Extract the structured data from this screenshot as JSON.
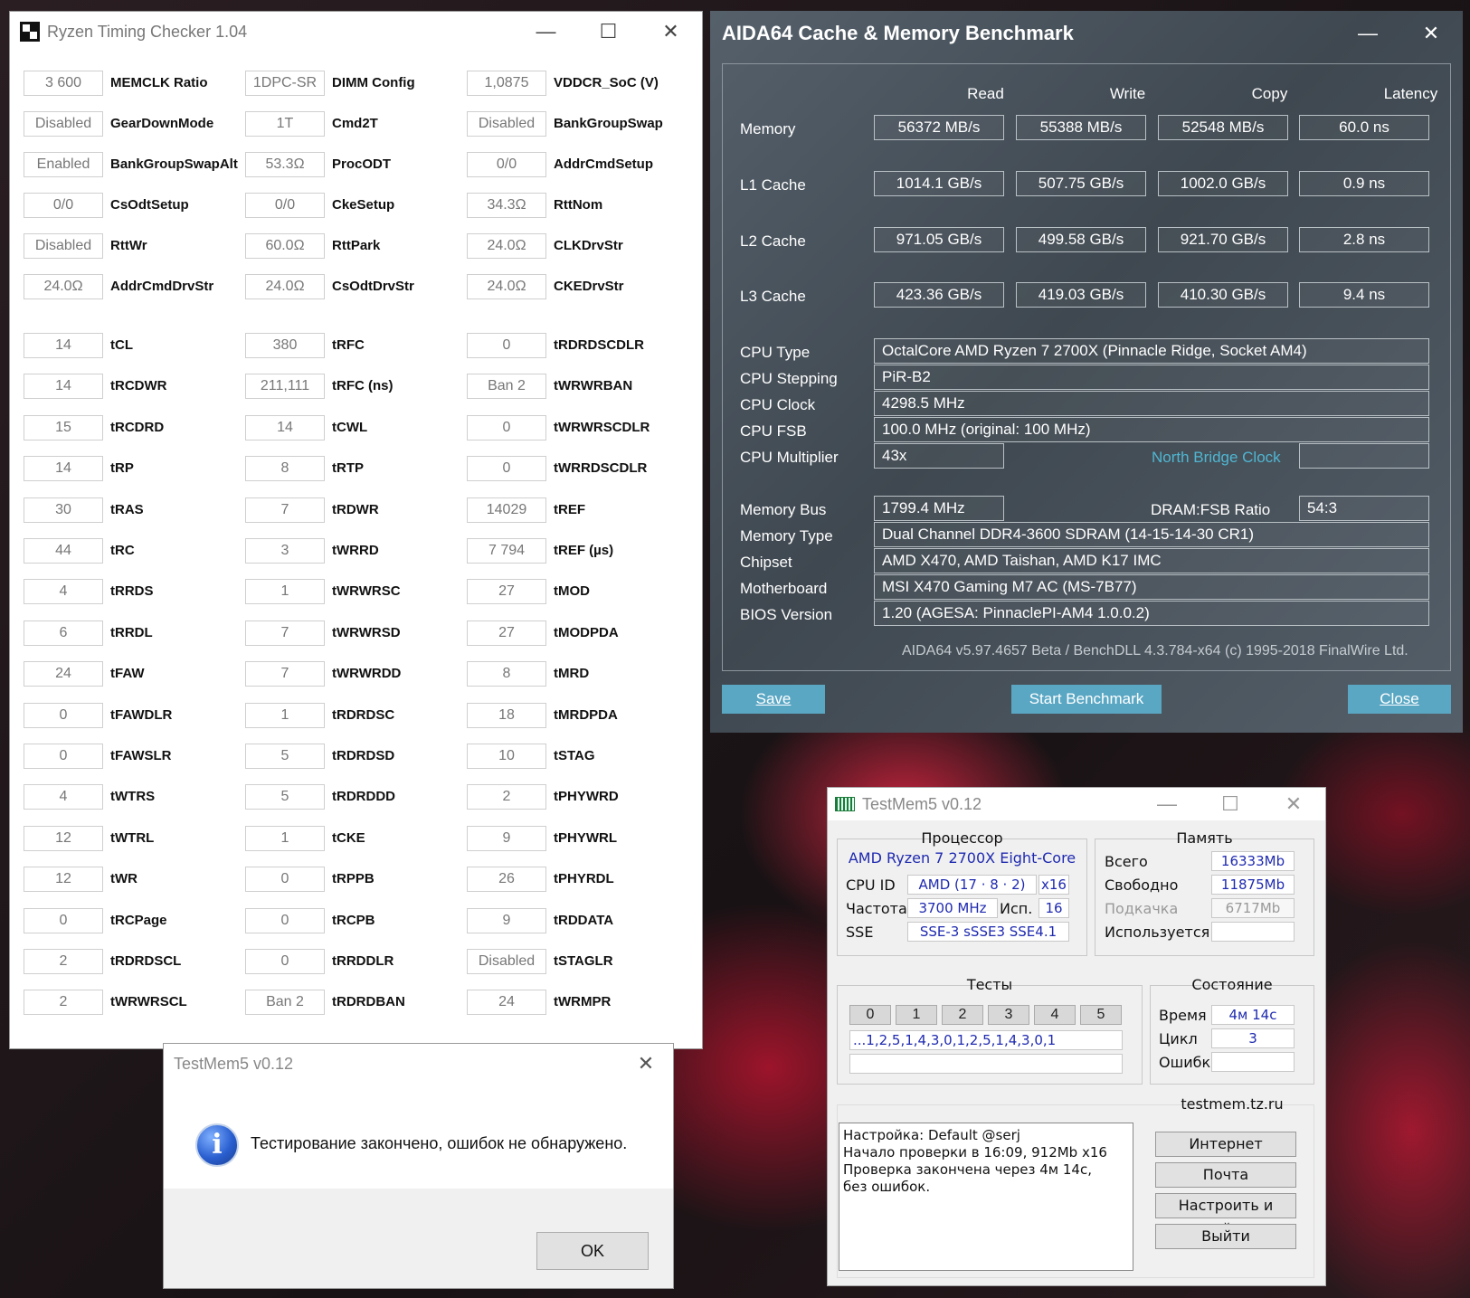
{
  "rtc": {
    "title": "Ryzen Timing Checker 1.04",
    "rows": [
      [
        {
          "v": "3 600",
          "l": "MEMCLK Ratio"
        },
        {
          "v": "1DPC-SR",
          "l": "DIMM Config"
        },
        {
          "v": "1,0875",
          "l": "VDDCR_SoC (V)"
        }
      ],
      [
        {
          "v": "Disabled",
          "l": "GearDownMode"
        },
        {
          "v": "1T",
          "l": "Cmd2T"
        },
        {
          "v": "Disabled",
          "l": "BankGroupSwap"
        }
      ],
      [
        {
          "v": "Enabled",
          "l": "BankGroupSwapAlt"
        },
        {
          "v": "53.3Ω",
          "l": "ProcODT"
        },
        {
          "v": "0/0",
          "l": "AddrCmdSetup"
        }
      ],
      [
        {
          "v": "0/0",
          "l": "CsOdtSetup"
        },
        {
          "v": "0/0",
          "l": "CkeSetup"
        },
        {
          "v": "34.3Ω",
          "l": "RttNom"
        }
      ],
      [
        {
          "v": "Disabled",
          "l": "RttWr"
        },
        {
          "v": "60.0Ω",
          "l": "RttPark"
        },
        {
          "v": "24.0Ω",
          "l": "CLKDrvStr"
        }
      ],
      [
        {
          "v": "24.0Ω",
          "l": "AddrCmdDrvStr"
        },
        {
          "v": "24.0Ω",
          "l": "CsOdtDrvStr"
        },
        {
          "v": "24.0Ω",
          "l": "CKEDrvStr"
        }
      ],
      [
        {
          "v": "14",
          "l": "tCL"
        },
        {
          "v": "380",
          "l": "tRFC"
        },
        {
          "v": "0",
          "l": "tRDRDSCDLR"
        }
      ],
      [
        {
          "v": "14",
          "l": "tRCDWR"
        },
        {
          "v": "211,111",
          "l": "tRFC (ns)"
        },
        {
          "v": "Ban 2",
          "l": "tWRWRBAN"
        }
      ],
      [
        {
          "v": "15",
          "l": "tRCDRD"
        },
        {
          "v": "14",
          "l": "tCWL"
        },
        {
          "v": "0",
          "l": "tWRWRSCDLR"
        }
      ],
      [
        {
          "v": "14",
          "l": "tRP"
        },
        {
          "v": "8",
          "l": "tRTP"
        },
        {
          "v": "0",
          "l": "tWRRDSCDLR"
        }
      ],
      [
        {
          "v": "30",
          "l": "tRAS"
        },
        {
          "v": "7",
          "l": "tRDWR"
        },
        {
          "v": "14029",
          "l": "tREF"
        }
      ],
      [
        {
          "v": "44",
          "l": "tRC"
        },
        {
          "v": "3",
          "l": "tWRRD"
        },
        {
          "v": "7 794",
          "l": "tREF (µs)"
        }
      ],
      [
        {
          "v": "4",
          "l": "tRRDS"
        },
        {
          "v": "1",
          "l": "tWRWRSC"
        },
        {
          "v": "27",
          "l": "tMOD"
        }
      ],
      [
        {
          "v": "6",
          "l": "tRRDL"
        },
        {
          "v": "7",
          "l": "tWRWRSD"
        },
        {
          "v": "27",
          "l": "tMODPDA"
        }
      ],
      [
        {
          "v": "24",
          "l": "tFAW"
        },
        {
          "v": "7",
          "l": "tWRWRDD"
        },
        {
          "v": "8",
          "l": "tMRD"
        }
      ],
      [
        {
          "v": "0",
          "l": "tFAWDLR"
        },
        {
          "v": "1",
          "l": "tRDRDSC"
        },
        {
          "v": "18",
          "l": "tMRDPDA"
        }
      ],
      [
        {
          "v": "0",
          "l": "tFAWSLR"
        },
        {
          "v": "5",
          "l": "tRDRDSD"
        },
        {
          "v": "10",
          "l": "tSTAG"
        }
      ],
      [
        {
          "v": "4",
          "l": "tWTRS"
        },
        {
          "v": "5",
          "l": "tRDRDDD"
        },
        {
          "v": "2",
          "l": "tPHYWRD"
        }
      ],
      [
        {
          "v": "12",
          "l": "tWTRL"
        },
        {
          "v": "1",
          "l": "tCKE"
        },
        {
          "v": "9",
          "l": "tPHYWRL"
        }
      ],
      [
        {
          "v": "12",
          "l": "tWR"
        },
        {
          "v": "0",
          "l": "tRPPB"
        },
        {
          "v": "26",
          "l": "tPHYRDL"
        }
      ],
      [
        {
          "v": "0",
          "l": "tRCPage"
        },
        {
          "v": "0",
          "l": "tRCPB"
        },
        {
          "v": "9",
          "l": "tRDDATA"
        }
      ],
      [
        {
          "v": "2",
          "l": "tRDRDSCL"
        },
        {
          "v": "0",
          "l": "tRRDDLR"
        },
        {
          "v": "Disabled",
          "l": "tSTAGLR"
        }
      ],
      [
        {
          "v": "2",
          "l": "tWRWRSCL"
        },
        {
          "v": "Ban 2",
          "l": "tRDRDBAN"
        },
        {
          "v": "24",
          "l": "tWRMPR"
        }
      ]
    ]
  },
  "aida": {
    "title": "AIDA64 Cache & Memory Benchmark",
    "col_read": "Read",
    "col_write": "Write",
    "col_copy": "Copy",
    "col_latency": "Latency",
    "mem_label": "Memory",
    "mem_read": "56372 MB/s",
    "mem_write": "55388 MB/s",
    "mem_copy": "52548 MB/s",
    "mem_lat": "60.0 ns",
    "l1_label": "L1 Cache",
    "l1_read": "1014.1 GB/s",
    "l1_write": "507.75 GB/s",
    "l1_copy": "1002.0 GB/s",
    "l1_lat": "0.9 ns",
    "l2_label": "L2 Cache",
    "l2_read": "971.05 GB/s",
    "l2_write": "499.58 GB/s",
    "l2_copy": "921.70 GB/s",
    "l2_lat": "2.8 ns",
    "l3_label": "L3 Cache",
    "l3_read": "423.36 GB/s",
    "l3_write": "419.03 GB/s",
    "l3_copy": "410.30 GB/s",
    "l3_lat": "9.4 ns",
    "cpu_type_label": "CPU Type",
    "cpu_type": "OctalCore AMD Ryzen 7 2700X  (Pinnacle Ridge, Socket AM4)",
    "cpu_stepping_label": "CPU Stepping",
    "cpu_stepping": "PiR-B2",
    "cpu_clock_label": "CPU Clock",
    "cpu_clock": "4298.5 MHz",
    "cpu_fsb_label": "CPU FSB",
    "cpu_fsb": "100.0 MHz  (original: 100 MHz)",
    "cpu_mult_label": "CPU Multiplier",
    "cpu_mult": "43x",
    "nb_clock_label": "North Bridge Clock",
    "nb_clock": "",
    "mem_bus_label": "Memory Bus",
    "mem_bus": "1799.4 MHz",
    "dram_ratio_label": "DRAM:FSB Ratio",
    "dram_ratio": "54:3",
    "mem_type_label": "Memory Type",
    "mem_type": "Dual Channel DDR4-3600 SDRAM  (14-15-14-30 CR1)",
    "chipset_label": "Chipset",
    "chipset": "AMD X470, AMD Taishan, AMD K17 IMC",
    "mobo_label": "Motherboard",
    "mobo": "MSI X470 Gaming M7 AC (MS-7B77)",
    "bios_label": "BIOS Version",
    "bios": "1.20  (AGESA: PinnaclePI-AM4 1.0.0.2)",
    "footer": "AIDA64 v5.97.4657 Beta / BenchDLL 4.3.784-x64  (c) 1995-2018 FinalWire Ltd.",
    "save": "Save",
    "start": "Start Benchmark",
    "close": "Close"
  },
  "tm5": {
    "title": "TestMem5 v0.12",
    "cpu_head": "Процессор",
    "cpu_name": "AMD Ryzen 7 2700X Eight-Core",
    "cpuid_label": "CPU ID",
    "cpuid": "AMD  (17 · 8 · 2)",
    "threads_x": "x16",
    "freq_label": "Частота",
    "freq": "3700 MHz",
    "used_label": "Исп.",
    "used": "16",
    "sse_label": "SSE",
    "sse": "SSE-3 sSSE3 SSE4.1",
    "mem_head": "Память",
    "total_label": "Всего",
    "total": "16333Mb",
    "free_label": "Свободно",
    "free": "11875Mb",
    "swap_label": "Подкачка",
    "swap": "6717Mb",
    "inuse_label": "Используется",
    "inuse": "",
    "tests_head": "Тесты",
    "tests": [
      "0",
      "1",
      "2",
      "3",
      "4",
      "5"
    ],
    "sequence": "...1,2,5,1,4,3,0,1,2,5,1,4,3,0,1",
    "sequence2": "",
    "state_head": "Состояние",
    "time_label": "Время",
    "time": "4м 14с",
    "cycle_label": "Цикл",
    "cycle": "3",
    "errors_label": "Ошибки",
    "errors": "",
    "log": [
      "Настройка: Default @serj",
      "Начало проверки в 16:09, 912Mb x16",
      "Проверка закончена через 4м 14с,",
      "без ошибок."
    ],
    "site": "testmem.tz.ru",
    "btn_internet": "Интернет",
    "btn_mail": "Почта",
    "btn_setup": "Настроить и выйти",
    "btn_exit": "Выйти"
  },
  "dialog": {
    "title": "TestMem5 v0.12",
    "message": "Тестирование закончено, ошибок не обнаружено.",
    "ok": "OK"
  }
}
